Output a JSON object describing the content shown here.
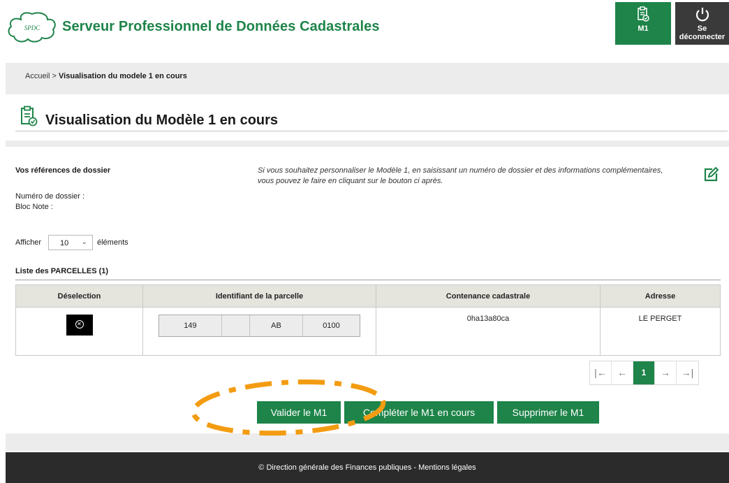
{
  "header": {
    "logo_text": "SPDC",
    "site_title": "Serveur Professionnel de Données Cadastrales",
    "m1_button": "M1",
    "logout_line1": "Se",
    "logout_line2": "déconnecter"
  },
  "breadcrumb": {
    "home": "Accueil",
    "separator": ">",
    "current": "Visualisation du modele 1 en cours"
  },
  "page_title": "Visualisation du Modèle 1 en cours",
  "refs": {
    "title": "Vos références de dossier",
    "dossier_label": "Numéro de dossier :",
    "bloc_note_label": "Bloc Note :",
    "info_text": "Si vous souhaitez personnaliser le Modèle 1, en saisissant un numéro de dossier et des informations complémentaires, vous pouvez le faire en cliquant sur le bouton ci après."
  },
  "length_control": {
    "prefix": "Afficher",
    "value": "10",
    "suffix": "éléments"
  },
  "list_title": "Liste des PARCELLES (1)",
  "table": {
    "columns": [
      "Déselection",
      "Identifiant de la parcelle",
      "Contenance cadastrale",
      "Adresse"
    ],
    "rows": [
      {
        "ident": [
          "149",
          "",
          "AB",
          "0100"
        ],
        "contenance": "0ha13a80ca",
        "adresse": "LE PERGET"
      }
    ]
  },
  "pager": {
    "first": "|←",
    "prev": "←",
    "current": "1",
    "next": "→",
    "last": "→|"
  },
  "actions": {
    "valider": "Valider le M1",
    "completer": "Compléter le M1 en cours",
    "supprimer": "Supprimer le M1"
  },
  "footer": "© Direction générale des Finances publiques - Mentions légales",
  "colors": {
    "brand_green": "#1e8449",
    "annotation_orange": "#f39c12"
  }
}
